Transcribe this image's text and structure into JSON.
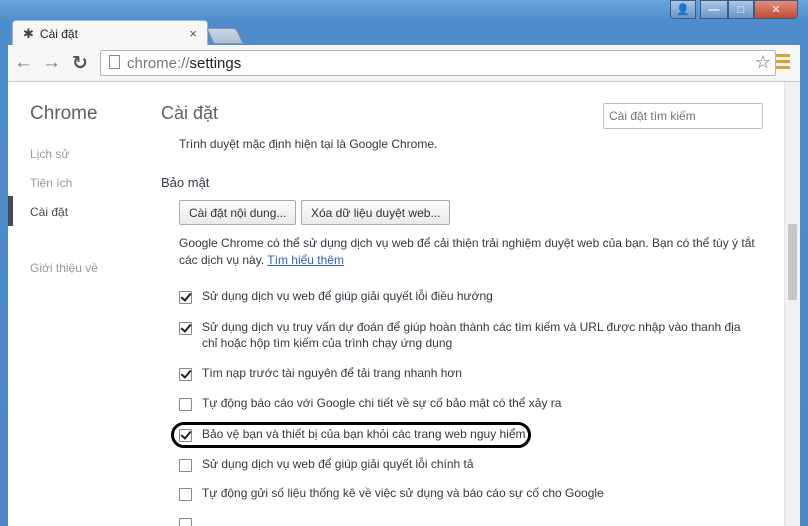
{
  "window": {
    "tab_title": "Cài đặt",
    "tab_close": "×",
    "controls": {
      "user": "👤",
      "minimize": "—",
      "maximize": "□",
      "close": "✕"
    }
  },
  "toolbar": {
    "back": "←",
    "forward": "→",
    "reload": "↻",
    "url_scheme": "chrome://",
    "url_path": "settings",
    "star": "☆"
  },
  "sidebar": {
    "brand": "Chrome",
    "items": [
      {
        "label": "Lịch sử"
      },
      {
        "label": "Tiện ích"
      },
      {
        "label": "Cài đặt"
      },
      {
        "label": "Giới thiệu về"
      }
    ]
  },
  "main": {
    "title": "Cài đặt",
    "search_placeholder": "Cài đặt tìm kiếm",
    "default_browser_text": "Trình duyệt mặc định hiện tại là Google Chrome.",
    "privacy": {
      "title": "Bảo mật",
      "content_settings_button": "Cài đặt nội dung...",
      "clear_data_button": "Xóa dữ liệu duyệt web...",
      "description": "Google Chrome có thể sử dụng dịch vụ web để cải thiện trải nghiệm duyệt web của bạn. Bạn có thể tùy ý tắt các dịch vụ này.",
      "learn_more": "Tìm hiểu thêm",
      "options": [
        {
          "label": "Sử dụng dịch vụ web để giúp giải quyết lỗi điều hướng",
          "checked": true
        },
        {
          "label": "Sử dụng dịch vụ truy vấn dự đoán để giúp hoàn thành các tìm kiếm và URL được nhập vào thanh địa chỉ hoặc hộp tìm kiếm của trình chạy ứng dụng",
          "checked": true
        },
        {
          "label": "Tìm nạp trước tài nguyên để tải trang nhanh hơn",
          "checked": true
        },
        {
          "label": "Tự động báo cáo với Google chi tiết về sự cố bảo mật có thể xảy ra",
          "checked": false
        },
        {
          "label": "Bảo vệ bạn và thiết bị của bạn khỏi các trang web nguy hiểm",
          "checked": true
        },
        {
          "label": "Sử dụng dịch vụ web để giúp giải quyết lỗi chính tả",
          "checked": false
        },
        {
          "label": "Tự động gửi số liệu thống kê về việc sử dụng và báo cáo sự cố cho Google",
          "checked": false
        }
      ]
    }
  }
}
